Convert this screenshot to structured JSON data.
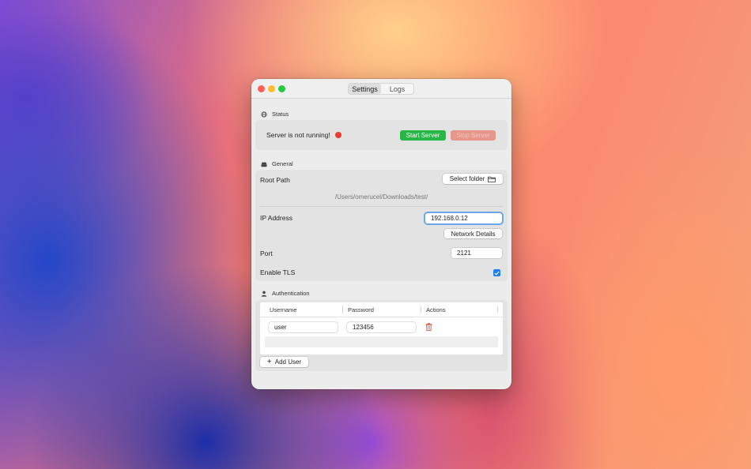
{
  "window": {
    "tabs": [
      {
        "label": "Settings",
        "active": true
      },
      {
        "label": "Logs",
        "active": false
      }
    ]
  },
  "status": {
    "section_title": "Status",
    "message": "Server is not running!",
    "indicator_color": "#ee3b30",
    "start_label": "Start Server",
    "stop_label": "Stop Server"
  },
  "general": {
    "section_title": "General",
    "root_path_label": "Root Path",
    "select_folder_label": "Select folder",
    "root_path_value": "/Users/omerucel/Downloads/test/",
    "ip_label": "IP Address",
    "ip_value": "192.168.0.12",
    "network_details_label": "Network Details",
    "port_label": "Port",
    "port_value": "2121",
    "tls_label": "Enable TLS",
    "tls_enabled": true
  },
  "auth": {
    "section_title": "Authentication",
    "columns": [
      "Username",
      "Password",
      "Actions"
    ],
    "users": [
      {
        "username": "user",
        "password": "123456"
      }
    ],
    "add_user_label": "Add User"
  },
  "colors": {
    "accent": "#1e7ef0",
    "start_button": "#27b745",
    "stop_button_disabled": "#e7968c",
    "delete_icon": "#e5574b"
  }
}
